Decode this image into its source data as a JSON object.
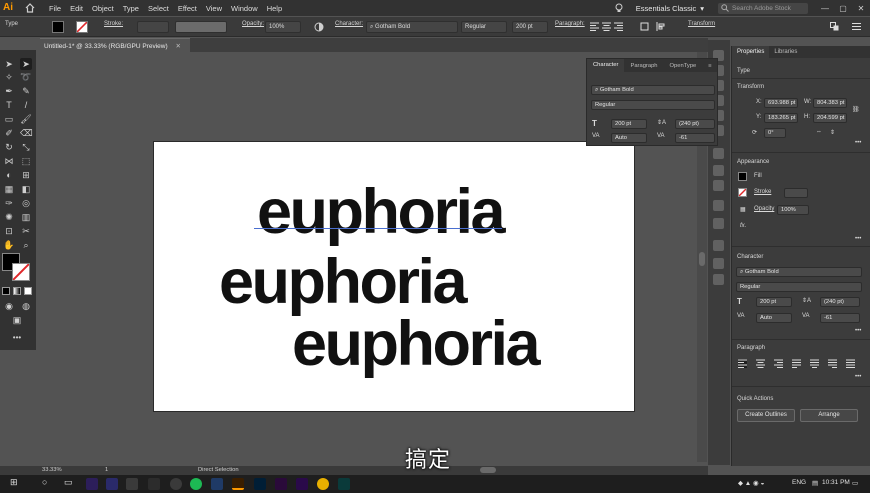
{
  "app": {
    "logo": "Ai",
    "menus": [
      "File",
      "Edit",
      "Object",
      "Type",
      "Select",
      "Effect",
      "View",
      "Window",
      "Help"
    ],
    "workspace": "Essentials Classic",
    "search_placeholder": "Search Adobe Stock"
  },
  "control_bar": {
    "type_label": "Type",
    "stroke_label": "Stroke:",
    "opacity_label": "Opacity:",
    "opacity_value": "100%",
    "character_label": "Character:",
    "font": "Gotham Bold",
    "style": "Regular",
    "size": "200 pt",
    "paragraph_label": "Paragraph:",
    "transform_label": "Transform"
  },
  "document": {
    "tab_title": "Untitled-1* @ 33.33% (RGB/GPU Preview)",
    "artboard_words": [
      "euphoria",
      "euphoria",
      "euphoria"
    ]
  },
  "character_panel": {
    "tabs": [
      "Character",
      "Paragraph",
      "OpenType"
    ],
    "font": "Gotham Bold",
    "style": "Regular",
    "size": "200 pt",
    "leading": "(240 pt)",
    "kerning": "Auto",
    "tracking": "-61"
  },
  "properties": {
    "tabs": [
      "Properties",
      "Libraries"
    ],
    "selection": "Type",
    "transform_title": "Transform",
    "x": "693.988 pt",
    "y": "183.265 pt",
    "w": "804.383 pt",
    "h": "204.599 pt",
    "rotate": "0°",
    "appearance_title": "Appearance",
    "fill_label": "Fill",
    "stroke_label": "Stroke",
    "opacity_label": "Opacity",
    "opacity_value": "100%",
    "fx_label": "fx.",
    "character_title": "Character",
    "font": "Gotham Bold",
    "style": "Regular",
    "size": "200 pt",
    "leading": "(240 pt)",
    "kerning": "Auto",
    "tracking": "-61",
    "paragraph_title": "Paragraph",
    "quick_actions_title": "Quick Actions",
    "create_outlines": "Create Outlines",
    "arrange": "Arrange"
  },
  "status_bar": {
    "zoom": "33.33%",
    "artboard": "1",
    "tool": "Direct Selection"
  },
  "taskbar": {
    "lang": "ENG",
    "time": "10:31 PM"
  },
  "subtitle": "搞定"
}
